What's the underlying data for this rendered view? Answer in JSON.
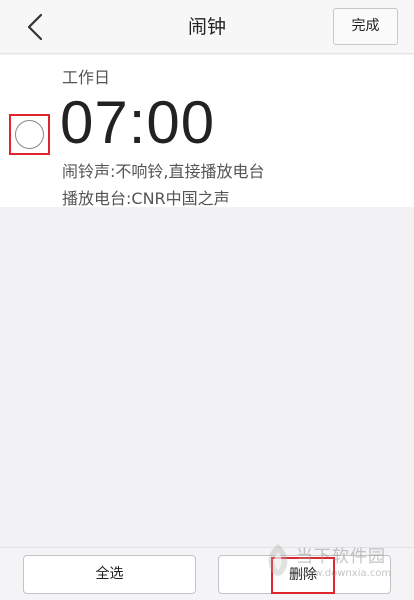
{
  "header": {
    "title": "闹钟",
    "done_label": "完成",
    "back_icon": "chevron-left-icon"
  },
  "alarm": {
    "repeat": "工作日",
    "time": "07:00",
    "ring_text": "闹铃声:不响铃,直接播放电台",
    "station_text": "播放电台:CNR中国之声",
    "selected": false
  },
  "bottom": {
    "select_all_label": "全选",
    "delete_label": "删除"
  },
  "watermark": {
    "name": "当下软件园",
    "url": "www.downxia.com"
  },
  "colors": {
    "highlight": "#e0262b",
    "text": "#222222",
    "muted": "#555555"
  }
}
